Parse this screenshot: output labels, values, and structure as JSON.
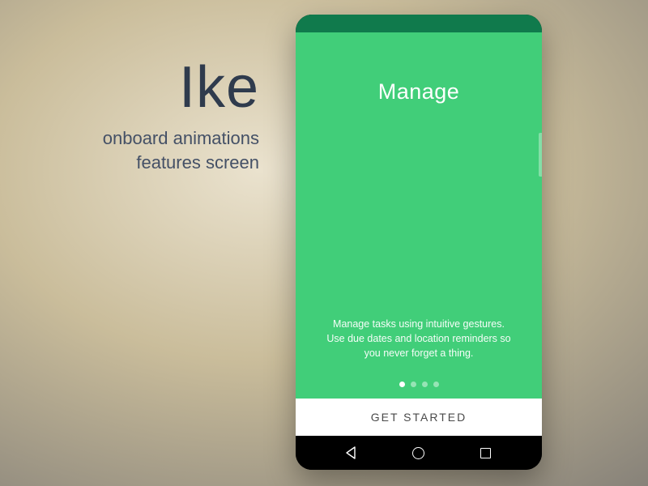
{
  "promo": {
    "app_name": "Ike",
    "tagline_line1": "onboard animations",
    "tagline_line2": "features screen"
  },
  "onboarding": {
    "title": "Manage",
    "description": "Manage tasks using intuitive gestures. Use due dates and location reminders so you never forget a thing.",
    "page_count": 4,
    "active_page_index": 0,
    "cta_label": "GET STARTED"
  },
  "colors": {
    "accent": "#41ce79",
    "accent_dark": "#107a4c"
  }
}
